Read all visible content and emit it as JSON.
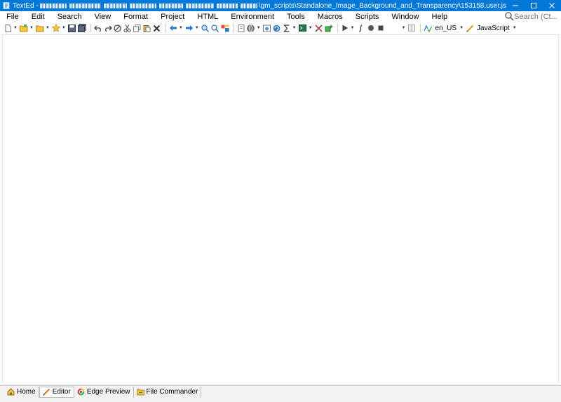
{
  "window": {
    "app_name": "TextEd - ",
    "path_visible": "\\gm_scripts\\Standalone_Image_Background_and_Transparency\\153158.user.js",
    "title_bg": "#0078d7"
  },
  "menu": {
    "items": [
      "File",
      "Edit",
      "Search",
      "View",
      "Format",
      "Project",
      "HTML",
      "Environment",
      "Tools",
      "Macros",
      "Scripts",
      "Window",
      "Help"
    ]
  },
  "search": {
    "placeholder": "Search (Ct..."
  },
  "toolbar": {
    "locale": "en_US",
    "language": "JavaScript"
  },
  "bottom_tabs": {
    "home": "Home",
    "editor": "Editor",
    "edge_preview": "Edge Preview",
    "file_commander": "File Commander"
  }
}
